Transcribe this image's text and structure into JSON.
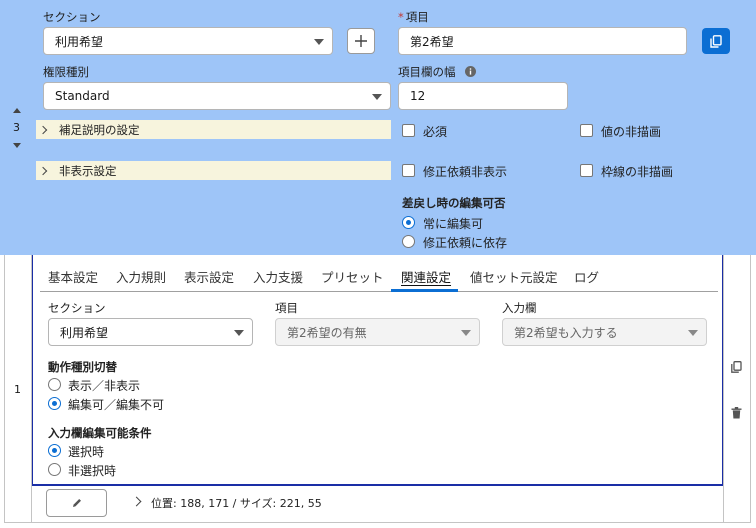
{
  "row_top": {
    "index": "3",
    "section_label": "セクション",
    "section_value": "利用希望",
    "item_required_mark": "*",
    "item_label": "項目",
    "item_value": "第2希望",
    "permission_label": "権限種別",
    "permission_value": "Standard",
    "width_label": "項目欄の幅",
    "width_value": "12",
    "expander_help": "補足説明の設定",
    "expander_hidden": "非表示設定",
    "checkboxes": {
      "required": "必須",
      "value_hidden": "値の非描画",
      "correction_hidden": "修正依頼非表示",
      "border_hidden": "枠線の非描画"
    },
    "sendback_title": "差戻し時の編集可否",
    "sendback_options": [
      "常に編集可",
      "修正依頼に依存"
    ],
    "sendback_selected": 0
  },
  "row_bottom": {
    "index": "1",
    "tabs": [
      "基本設定",
      "入力規則",
      "表示設定",
      "入力支援",
      "プリセット",
      "関連設定",
      "値セット元設定",
      "ログ"
    ],
    "active_tab": 5,
    "fields": {
      "section_label": "セクション",
      "section_value": "利用希望",
      "item_label": "項目",
      "item_value": "第2希望の有無",
      "input_label": "入力欄",
      "input_value": "第2希望も入力する"
    },
    "action_title": "動作種別切替",
    "action_options": [
      "表示／非表示",
      "編集可／編集不可"
    ],
    "action_selected": 1,
    "condition_title": "入力欄編集可能条件",
    "condition_options": [
      "選択時",
      "非選択時"
    ],
    "condition_selected": 0,
    "footer_text": "位置: 188, 171 / サイズ: 221, 55"
  },
  "colors": {
    "top_bg": "#9ec5f8",
    "accent": "#0b6ed3",
    "panel_border": "#1a2ea6",
    "expander_bg": "#f7f4dd"
  },
  "icons": [
    "plus-icon",
    "copy-icon",
    "info-icon",
    "chevron-right-icon",
    "caret-up-icon",
    "caret-down-icon",
    "pencil-icon",
    "trash-icon"
  ]
}
